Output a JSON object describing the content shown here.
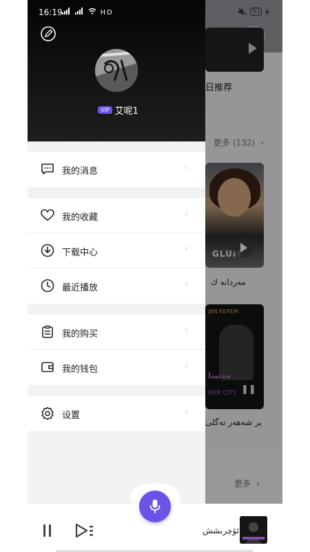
{
  "status_bar": {
    "time": "16:19",
    "network": "HD",
    "battery": "53"
  },
  "user": {
    "vip_badge": "VIP",
    "name": "艾呢1"
  },
  "menu": {
    "messages": "我的消息",
    "favorites": "我的收藏",
    "downloads": "下载中心",
    "recent": "最近播放",
    "purchases": "我的购买",
    "wallet": "我的钱包",
    "settings": "设置"
  },
  "background": {
    "daily_recommend": "日推荐",
    "more_count": "更多 (132)",
    "song_caption_1": "مەردانە ك",
    "album_top_text": "JAN KEREM",
    "album_title_text": "HER CITY",
    "song_caption_2": "ېر شەھەر تەگلى",
    "more": "更多",
    "img1_text": "GLUM"
  },
  "player": {
    "now_playing": "ئۆچرىشش"
  },
  "colors": {
    "accent": "#6a54e8",
    "drawer_header": "#0b0b0b"
  }
}
